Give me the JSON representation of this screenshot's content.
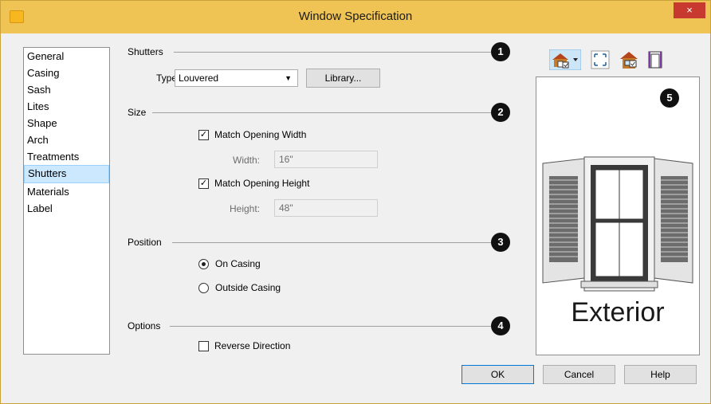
{
  "window": {
    "title": "Window Specification",
    "close": "×"
  },
  "sidebar": {
    "items": [
      {
        "label": "General"
      },
      {
        "label": "Casing"
      },
      {
        "label": "Sash"
      },
      {
        "label": "Lites"
      },
      {
        "label": "Shape"
      },
      {
        "label": "Arch"
      },
      {
        "label": "Treatments"
      },
      {
        "label": "Shutters",
        "selected": true
      },
      {
        "label": "Materials"
      },
      {
        "label": "Label"
      }
    ]
  },
  "shutters": {
    "group": "Shutters",
    "type_label": "Type:",
    "type_value": "Louvered",
    "library": "Library..."
  },
  "size": {
    "group": "Size",
    "match_width": "Match Opening Width",
    "match_width_checked": true,
    "width_label": "Width:",
    "width_value": "16\"",
    "match_height": "Match Opening Height",
    "match_height_checked": true,
    "height_label": "Height:",
    "height_value": "48\""
  },
  "position": {
    "group": "Position",
    "on_casing": "On Casing",
    "outside_casing": "Outside Casing",
    "selected": "on_casing"
  },
  "options": {
    "group": "Options",
    "reverse": "Reverse Direction",
    "reverse_checked": false
  },
  "markers": [
    "1",
    "2",
    "3",
    "4",
    "5"
  ],
  "preview": {
    "label": "Exterior",
    "toolbar_icons": [
      "house-view-icon",
      "fill-window-icon",
      "display-options-icon",
      "color-icon"
    ]
  },
  "buttons": {
    "ok": "OK",
    "cancel": "Cancel",
    "help": "Help"
  },
  "colors": {
    "titlebar": "#f0c454",
    "selection": "#cce8ff",
    "accent": "#0078d7"
  }
}
